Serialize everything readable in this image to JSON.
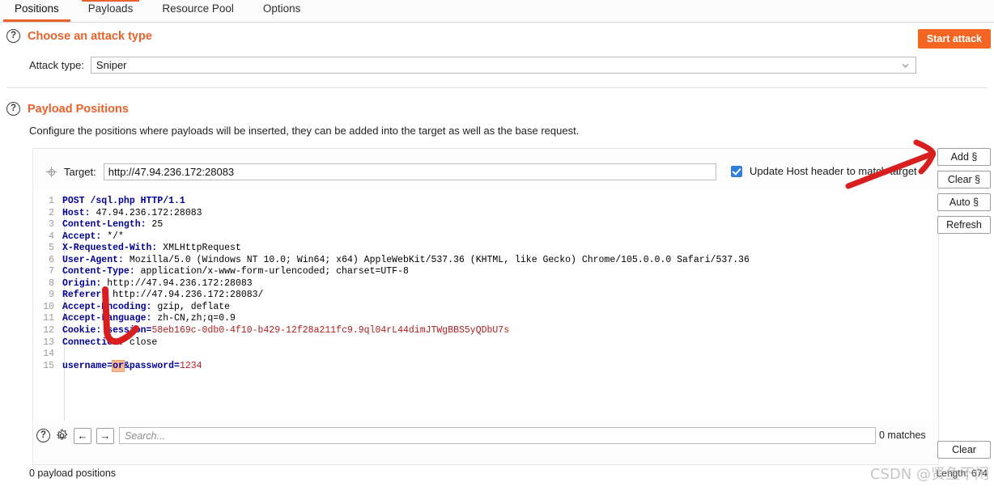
{
  "tabs": [
    {
      "label": "Positions",
      "active": true
    },
    {
      "label": "Payloads",
      "active": false
    },
    {
      "label": "Resource Pool",
      "active": false
    },
    {
      "label": "Options",
      "active": false
    }
  ],
  "attack_section": {
    "help_glyph": "?",
    "title": "Choose an attack type",
    "field_label": "Attack type:",
    "attack_type_value": "Sniper",
    "start_attack_label": "Start attack"
  },
  "positions_section": {
    "help_glyph": "?",
    "title": "Payload Positions",
    "description": "Configure the positions where payloads will be inserted, they can be added into the target as well as the base request.",
    "target_label": "Target:",
    "target_value": "http://47.94.236.172:28083",
    "update_host_label": "Update Host header to match target",
    "update_host_checked": true
  },
  "side_buttons": [
    {
      "label": "Add §"
    },
    {
      "label": "Clear §"
    },
    {
      "label": "Auto §"
    },
    {
      "label": "Refresh"
    }
  ],
  "request": {
    "lines": [
      {
        "n": 1,
        "text": "POST /sql.php HTTP/1.1"
      },
      {
        "n": 2,
        "text": "Host: 47.94.236.172:28083"
      },
      {
        "n": 3,
        "text": "Content-Length: 25"
      },
      {
        "n": 4,
        "text": "Accept: */*"
      },
      {
        "n": 5,
        "text": "X-Requested-With: XMLHttpRequest"
      },
      {
        "n": 6,
        "text": "User-Agent: Mozilla/5.0 (Windows NT 10.0; Win64; x64) AppleWebKit/537.36 (KHTML, like Gecko) Chrome/105.0.0.0 Safari/537.36"
      },
      {
        "n": 7,
        "text": "Content-Type: application/x-www-form-urlencoded; charset=UTF-8"
      },
      {
        "n": 8,
        "text": "Origin: http://47.94.236.172:28083"
      },
      {
        "n": 9,
        "text": "Referer: http://47.94.236.172:28083/"
      },
      {
        "n": 10,
        "text": "Accept-Encoding: gzip, deflate"
      },
      {
        "n": 11,
        "text": "Accept-Language: zh-CN,zh;q=0.9"
      },
      {
        "n": 12,
        "text": "Cookie: session=58eb169c-0db0-4f10-b429-12f28a211fc9.9ql04rL44dimJTWgBBS5yQDbU7s"
      },
      {
        "n": 13,
        "text": "Connection: close"
      },
      {
        "n": 14,
        "text": ""
      },
      {
        "n": 15,
        "text": "username=or&password=1234"
      }
    ],
    "headers": {
      "line1_method": "POST /sql.php HTTP/1.1",
      "host_name": "Host:",
      "host_value": " 47.94.236.172:28083",
      "clen_name": "Content-Length:",
      "clen_value": " 25",
      "accept_name": "Accept:",
      "accept_value": " */*",
      "xrw_name": "X-Requested-With:",
      "xrw_value": " XMLHttpRequest",
      "ua_name": "User-Agent:",
      "ua_value": " Mozilla/5.0 (Windows NT 10.0; Win64; x64) AppleWebKit/537.36 (KHTML, like Gecko) Chrome/105.0.0.0 Safari/537.36",
      "ctype_name": "Content-Type:",
      "ctype_value": " application/x-www-form-urlencoded; charset=UTF-8",
      "origin_name": "Origin:",
      "origin_value": " http://47.94.236.172:28083",
      "referer_name": "Referer:",
      "referer_value": " http://47.94.236.172:28083/",
      "aenc_name": "Accept-Encoding:",
      "aenc_value": " gzip, deflate",
      "alang_name": "Accept-Language:",
      "alang_value": " zh-CN,zh;q=0.9",
      "cookie_name": "Cookie:",
      "cookie_key": " session=",
      "cookie_value": "58eb169c-0db0-4f10-b429-12f28a211fc9.9ql04rL44dimJTWgBBS5yQDbU7s",
      "conn_name": "Connection:",
      "conn_value": " close",
      "body_user_key": "username=",
      "body_marked_value": "or",
      "body_amp": "&",
      "body_pass_key": "password=",
      "body_pass_value": "1234"
    },
    "line_numbers": [
      "1",
      "2",
      "3",
      "4",
      "5",
      "6",
      "7",
      "8",
      "9",
      "10",
      "11",
      "12",
      "13",
      "14",
      "15"
    ]
  },
  "editor_bar": {
    "help_glyph": "?",
    "prev_glyph": "←",
    "next_glyph": "→",
    "search_placeholder": "Search...",
    "search_value": "",
    "matches_text": "0 matches",
    "clear_label": "Clear"
  },
  "footer": {
    "payload_positions_text": "0 payload positions",
    "length_text": "Length: 674",
    "watermark": "CSDN @贤鱼不闲"
  },
  "colors": {
    "accent_orange": "#e8622a",
    "start_attack_bg": "#f26522",
    "header_blue": "#00009b",
    "value_red": "#b02020",
    "marker_highlight": "#f7ba92",
    "checkbox_blue": "#2f7fe0",
    "annotation_red": "#d81f1f"
  }
}
